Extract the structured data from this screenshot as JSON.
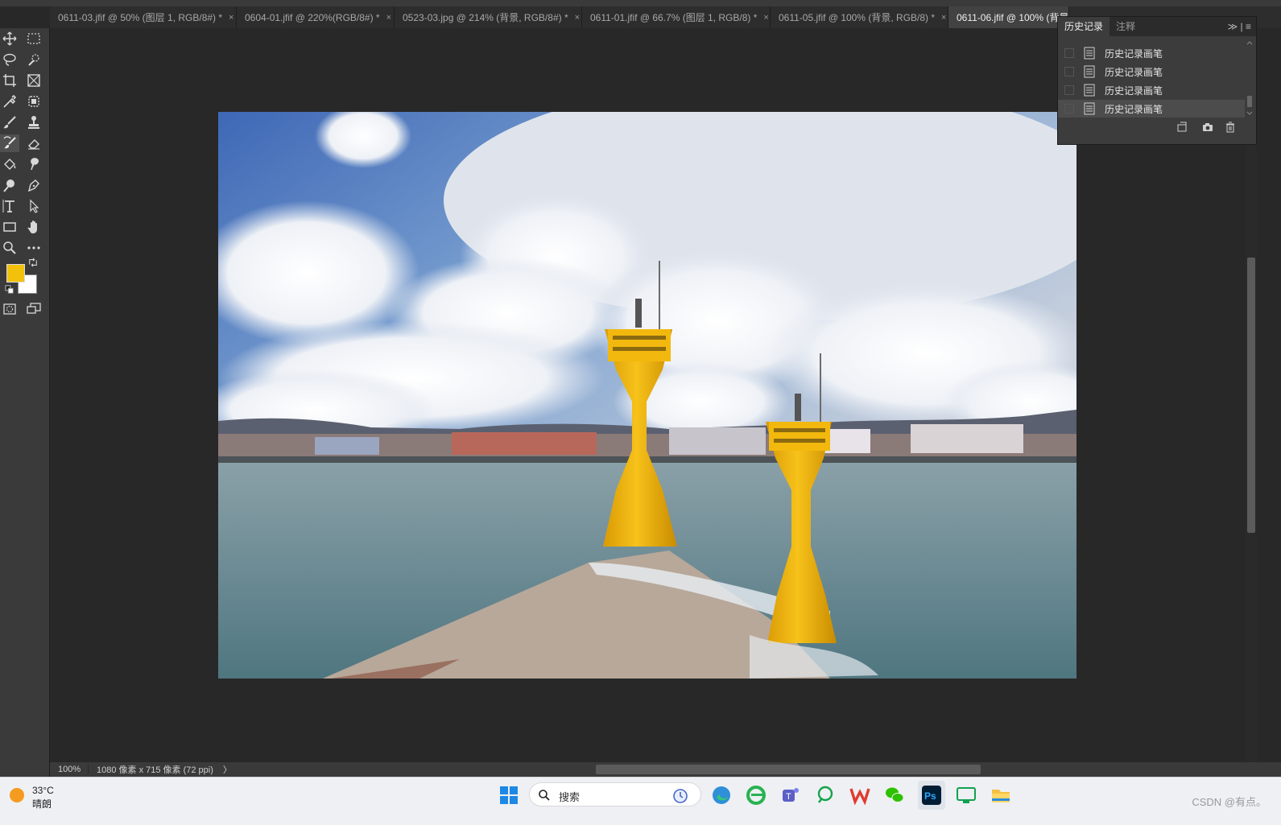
{
  "tabs": [
    {
      "label": "0611-03.jfif @ 50% (图层 1, RGB/8#) *",
      "close": "×",
      "active": false
    },
    {
      "label": "0604-01.jfif @ 220%(RGB/8#) *",
      "close": "×",
      "active": false
    },
    {
      "label": "0523-03.jpg @ 214% (背景, RGB/8#) *",
      "close": "×",
      "active": false
    },
    {
      "label": "0611-01.jfif @ 66.7% (图层 1, RGB/8) *",
      "close": "×",
      "active": false
    },
    {
      "label": "0611-05.jfif @ 100% (背景, RGB/8) *",
      "close": "×",
      "active": false
    },
    {
      "label": "0611-06.jfif @ 100% (背景",
      "close": "",
      "active": true
    }
  ],
  "history_panel": {
    "tabs": [
      "历史记录",
      "注释"
    ],
    "menu": "≫ | ≡",
    "items": [
      "历史记录画笔",
      "历史记录画笔",
      "历史记录画笔",
      "历史记录画笔"
    ],
    "selected_index": 3
  },
  "colors": {
    "foreground": "#f2c10c",
    "background": "#ffffff"
  },
  "status": {
    "zoom": "100%",
    "dimensions": "1080 像素 x 715 像素 (72 ppi)",
    "arrow": "〉"
  },
  "taskbar": {
    "weather_temp": "33°C",
    "weather_desc": "晴朗",
    "search_placeholder": "搜索",
    "watermark": "CSDN @有点。"
  },
  "tools": [
    "move-tool-icon",
    "marquee-tool-icon",
    "lasso-tool-icon",
    "quick-select-icon",
    "crop-tool-icon",
    "frame-tool-icon",
    "eyedropper-icon",
    "patch-tool-icon",
    "brush-tool-icon",
    "stamp-tool-icon",
    "history-brush-icon",
    "eraser-icon",
    "bucket-icon",
    "smudge-icon",
    "dodge-icon",
    "pen-tool-icon",
    "type-tool-icon",
    "path-select-icon",
    "rectangle-tool-icon",
    "hand-tool-icon",
    "zoom-tool-icon",
    "more-tools-icon"
  ]
}
